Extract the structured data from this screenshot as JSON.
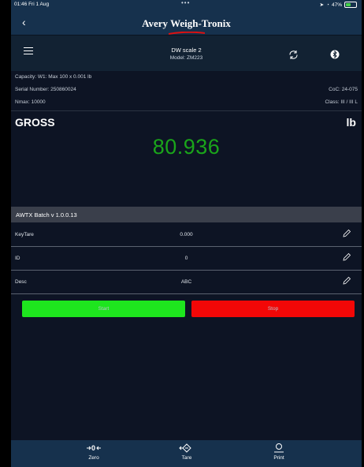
{
  "status_bar": {
    "time": "01:46  Fri 1 Aug",
    "dots": "•••",
    "battery": "47%",
    "battery_level": 0.47
  },
  "nav": {
    "brand": "Avery Weigh-Tronix"
  },
  "header": {
    "scale_name": "DW scale 2",
    "model": "Model: ZM223"
  },
  "info": {
    "capacity": "Capacity: W1: Max 100 x 0.001 lb",
    "serial": "Serial Number: 250860024",
    "coc": "CoC: 24-075",
    "nmax": "Nmax: 10000",
    "class": "Class: III / III L"
  },
  "display": {
    "mode": "GROSS",
    "unit": "lb",
    "weight": "80.936"
  },
  "batch": {
    "title": "AWTX Batch v 1.0.0.13",
    "fields": [
      {
        "label": "KeyTare",
        "value": "0.000"
      },
      {
        "label": "ID",
        "value": "0"
      },
      {
        "label": "Desc",
        "value": "ABC"
      }
    ],
    "start_label": "Start",
    "stop_label": "Stop"
  },
  "bottom_tabs": [
    {
      "label": "Zero",
      "icon": "zero-icon"
    },
    {
      "label": "Tare",
      "icon": "tare-icon"
    },
    {
      "label": "Print",
      "icon": "print-icon"
    }
  ],
  "colors": {
    "weight": "#1aa51a",
    "start": "#1ee51e",
    "stop": "#f20707",
    "bar": "#16314d"
  }
}
